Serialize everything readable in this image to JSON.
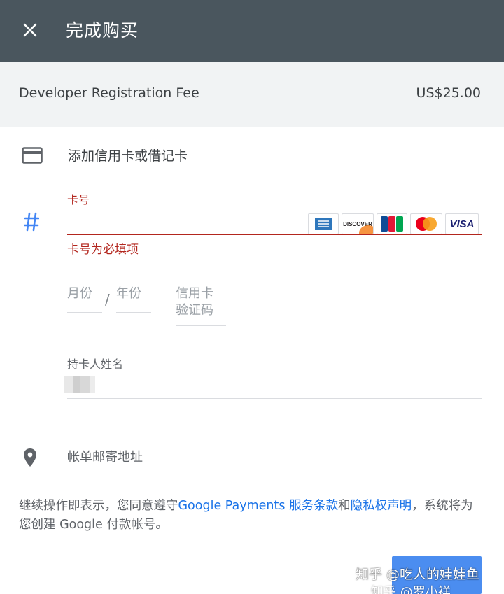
{
  "header": {
    "title": "完成购买",
    "close_icon": "close-icon"
  },
  "order": {
    "item_name": "Developer Registration Fee",
    "price": "US$25.00"
  },
  "payment": {
    "add_card_label": "添加信用卡或借记卡",
    "card_icon": "credit-card-icon",
    "card_number": {
      "label": "卡号",
      "value": "",
      "error": "卡号为必填项",
      "icon": "hash-icon"
    },
    "card_brands": [
      {
        "name": "amex",
        "label": ""
      },
      {
        "name": "discover",
        "label": "DISCOVER"
      },
      {
        "name": "jcb",
        "label": "JCB"
      },
      {
        "name": "mastercard",
        "label": ""
      },
      {
        "name": "visa",
        "label": "VISA"
      }
    ],
    "month_placeholder": "月份",
    "separator": "/",
    "year_placeholder": "年份",
    "cvc_placeholder_line1": "信用卡",
    "cvc_placeholder_line2": "验证码",
    "cardholder": {
      "label": "持卡人姓名",
      "value_blurred": true
    },
    "billing_address": {
      "placeholder": "帐单邮寄地址",
      "icon": "location-pin-icon"
    }
  },
  "terms": {
    "prefix": "继续操作即表示，您同意遵守",
    "link_payments": "Google Payments 服务条款",
    "and": "和",
    "link_privacy": "隐私权声明",
    "suffix": "，系统将为您创建 Google 付款帐号。"
  },
  "watermark": {
    "line1": "知乎 @吃人的娃娃鱼",
    "line2": "知乎 @罗小祥"
  },
  "colors": {
    "header_bg": "#4a565e",
    "summary_bg": "#f1f3f4",
    "error": "#b3261e",
    "link": "#1a73e8",
    "button": "#4b8df0"
  }
}
